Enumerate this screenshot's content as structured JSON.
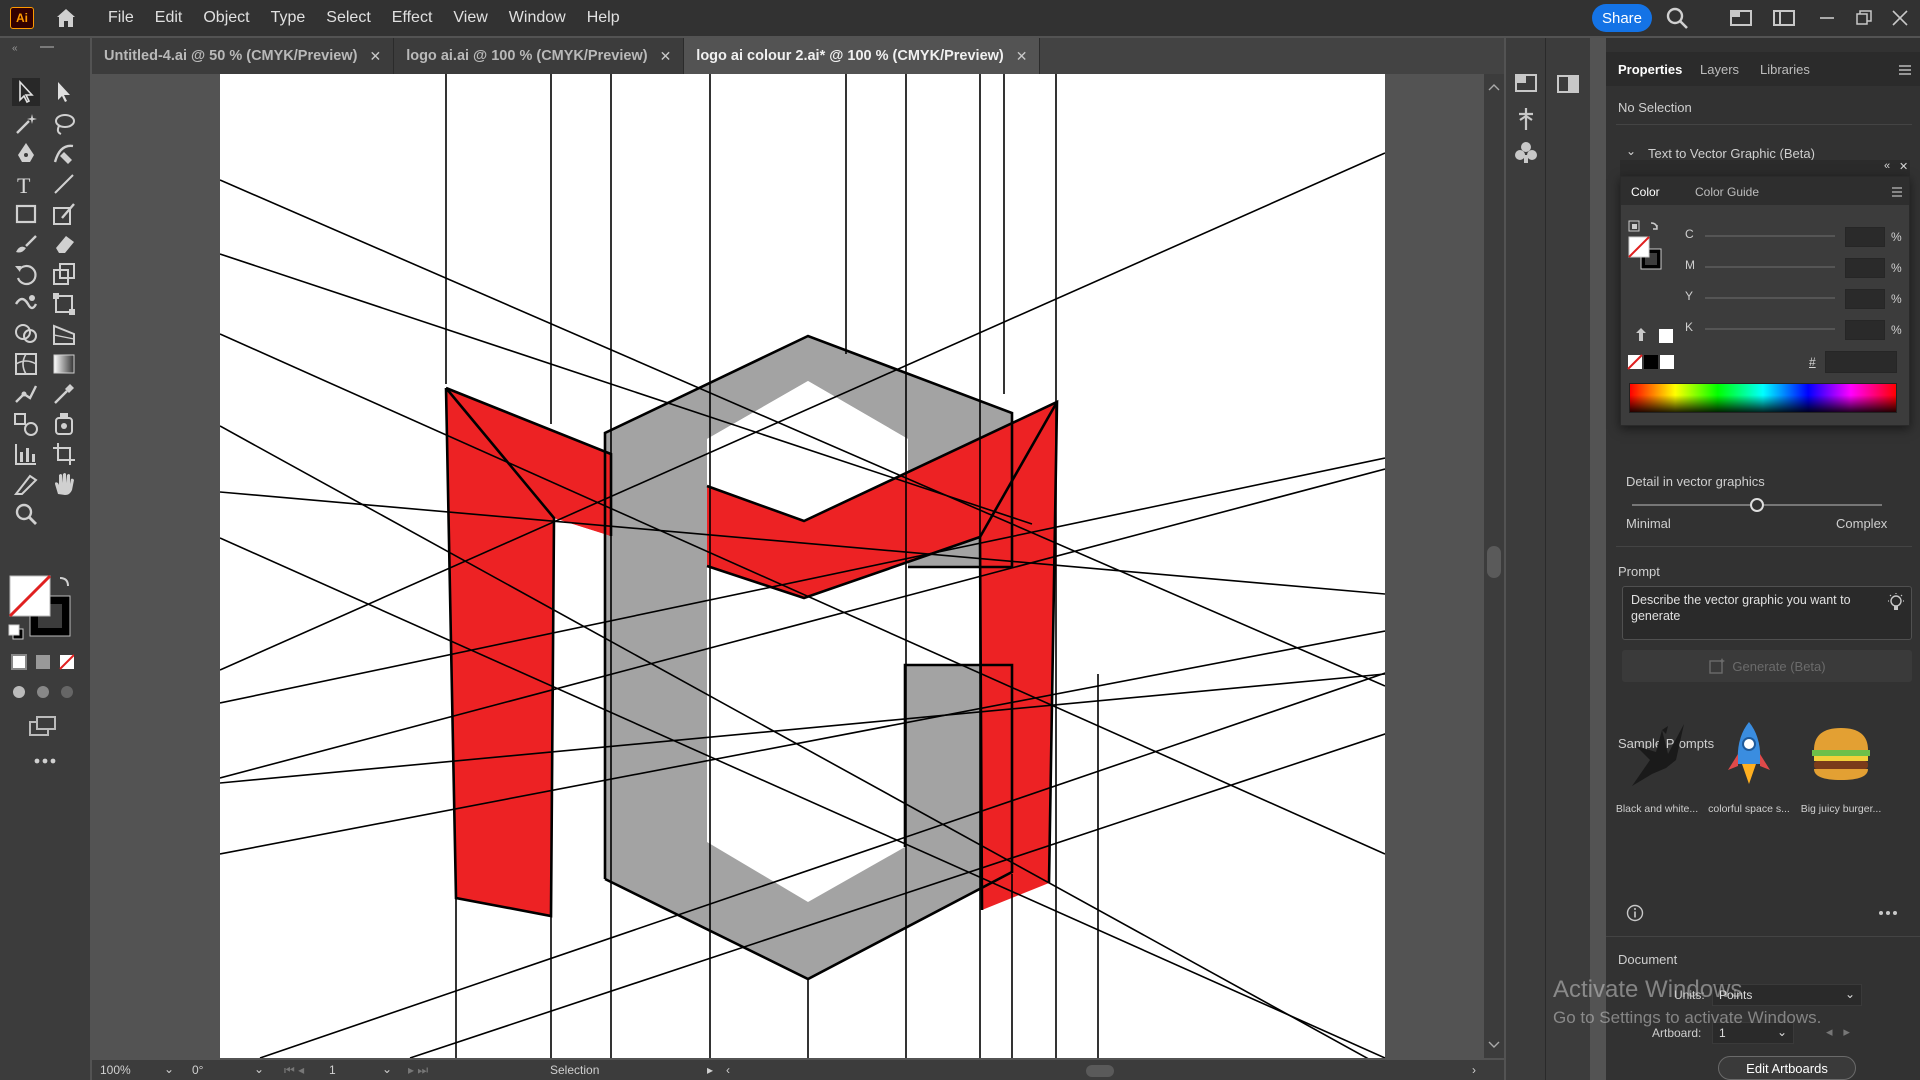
{
  "app": {
    "logo": "Ai"
  },
  "menu": [
    "File",
    "Edit",
    "Object",
    "Type",
    "Select",
    "Effect",
    "View",
    "Window",
    "Help"
  ],
  "share_label": "Share",
  "tabs": [
    {
      "label": "Untitled-4.ai @ 50 % (CMYK/Preview)",
      "active": false
    },
    {
      "label": "logo ai.ai @ 100 % (CMYK/Preview)",
      "active": false
    },
    {
      "label": "logo ai colour 2.ai* @ 100 % (CMYK/Preview)",
      "active": true
    }
  ],
  "tab_close": "✕",
  "status": {
    "zoom": "100%",
    "rotation": "0°",
    "artboard": "1",
    "mode": "Selection"
  },
  "panel": {
    "tabs": [
      "Properties",
      "Layers",
      "Libraries"
    ],
    "no_selection": "No Selection",
    "section_title": "Text to Vector Graphic (Beta)",
    "color_tabs": [
      "Color",
      "Color Guide"
    ],
    "cmyk_labels": [
      "C",
      "M",
      "Y",
      "K"
    ],
    "pct": "%",
    "hash": "#",
    "detail_label": "Detail in vector graphics",
    "detail_min": "Minimal",
    "detail_max": "Complex",
    "detail_value": 0.5,
    "prompt_label": "Prompt",
    "prompt_placeholder": "Describe the vector graphic you want to generate",
    "generate_label": "Generate (Beta)",
    "sample_title": "Sample Prompts",
    "samples": [
      "Black and white...",
      "colorful space s...",
      "Big juicy burger..."
    ],
    "document_label": "Document",
    "units_label": "Units:",
    "units_value": "Points",
    "artboard_label": "Artboard:",
    "artboard_value": "1",
    "edit_artboards": "Edit Artboards"
  },
  "watermark": {
    "line1": "Activate Windows",
    "line2": "Go to Settings to activate Windows."
  },
  "colors": {
    "red": "#ed2224",
    "gray": "#a3a3a3",
    "accent": "#1473e6"
  }
}
